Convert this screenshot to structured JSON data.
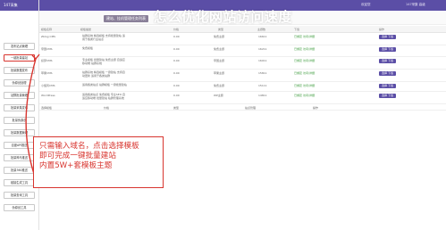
{
  "app": {
    "title": "147采集",
    "overlay_title": "怎么优化网站访问速度"
  },
  "topbar": {
    "right_items": [
      "欢迎您",
      "147采集 高级"
    ]
  },
  "breadcrumb": {
    "tab_label": "建站、挂机管理任务列表"
  },
  "sidebar": {
    "items": [
      {
        "label": "发布站点管理"
      },
      {
        "label": "一键批量建站"
      },
      {
        "label": "批量数据发布"
      },
      {
        "label": "伪原创处理"
      },
      {
        "label": "站群批量管理"
      },
      {
        "label": "批量采集发布"
      },
      {
        "label": "批量伪原创"
      },
      {
        "label": "批量数据管理"
      },
      {
        "label": "百度API推送"
      },
      {
        "label": "批量神马推送"
      },
      {
        "label": "批量360推送"
      },
      {
        "label": "链接生成工具"
      },
      {
        "label": "批量查询工具"
      },
      {
        "label": "伪原创工具"
      }
    ]
  },
  "table": {
    "headers": [
      "模板名称",
      "模板描述",
      "价格",
      "类型",
      "主题数",
      "下载",
      "操作"
    ],
    "rows": [
      {
        "name": "Zblog CMS",
        "desc": "站群系统 精选模板 支持批量建站 适用于各类行业站点",
        "price": "0.00",
        "type": "免费主题",
        "count": "16611",
        "link": "已绑定 访问/详细",
        "action": "选择 下载"
      },
      {
        "name": "帝国CMS",
        "desc": "免费模板",
        "price": "0.00",
        "type": "免费主题",
        "count": "16211",
        "link": "已绑定 访问/详细",
        "action": "选择 下载"
      },
      {
        "name": "织梦CMS",
        "desc": "专业模板 批量建站 免费主题 自适应移动端 站群系统",
        "price": "0.00",
        "type": "帝国主题",
        "count": "16011",
        "link": "已绑定 访问/详细",
        "action": "选择 下载"
      },
      {
        "name": "苹果CMS",
        "desc": "站群系统 精选模板 一键建站 支持自动更新 适用于各类站群",
        "price": "0.00",
        "type": "苹果主题",
        "count": "15811",
        "link": "已绑定 访问/详细",
        "action": "选择 下载"
      },
      {
        "name": "小旋风CMS",
        "desc": "适用各类站点 站群模板 一键批量建站",
        "price": "0.00",
        "type": "免费主题",
        "count": "15111",
        "link": "已绑定 访问/详细",
        "action": "选择 下载"
      },
      {
        "name": "WordPress",
        "desc": "适用各类站点 免费模板 专业SEO 自适应移动端 批量建站 站群管理系统",
        "price": "0.00",
        "type": "WP主题",
        "count": "14811",
        "link": "已绑定 访问/详细",
        "action": "选择 下载"
      }
    ],
    "footer": {
      "label": "选择模板",
      "a": "价格",
      "b": "类型",
      "c": "站点管理",
      "d": "操作"
    }
  },
  "callout": {
    "lines": [
      "只需输入域名，点击选择模板",
      "即可完成一键批量建站",
      "内置5W+套模板主题"
    ]
  },
  "colors": {
    "brand": "#5b4ea6",
    "annotation": "#d8352f"
  }
}
